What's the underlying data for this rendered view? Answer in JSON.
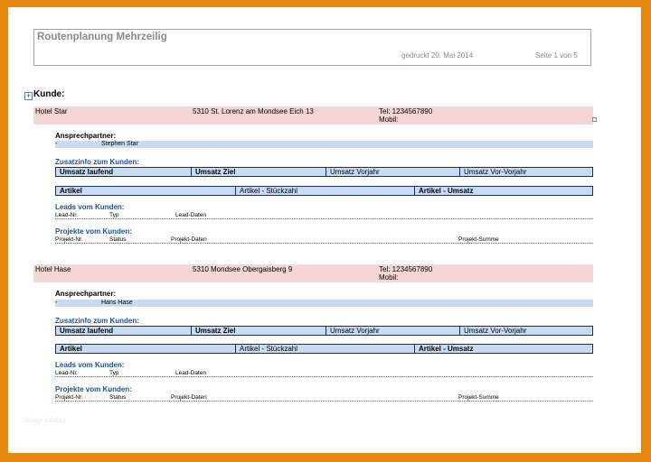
{
  "report": {
    "title": "Routenplanung Mehrzeilig",
    "printed": "gedruckt 20. Mai 2014",
    "page": "Seite 1 von 5",
    "group_label": "Kunde:",
    "expand_glyph": "+"
  },
  "labels": {
    "ansprechpartner": "Ansprechpartner:",
    "zusatzinfo": "Zusatzinfo zum Kunden:",
    "umsatz_laufend": "Umsatz laufend",
    "umsatz_ziel": "Umsatz Ziel",
    "umsatz_vorjahr": "Umsatz Vorjahr",
    "umsatz_vorvorjahr": "Umsatz Vor-Vorjahr",
    "artikel": "Artikel",
    "artikel_stueckzahl": "Artikel - Stückzahl",
    "artikel_umsatz": "Artikel - Umsatz",
    "leads": "Leads vom Kunden:",
    "lead_nr": "Lead-Nr.",
    "typ": "Typ",
    "lead_daten": "Lead-Daten",
    "projekte": "Projekte vom Kunden:",
    "projekt_nr": "Projekt-Nr.",
    "status": "Status",
    "projekt_daten": "Projekt-Daten",
    "projekt_summe": "Projekt-Summe"
  },
  "customers": [
    {
      "name": "Hotel Star",
      "address": "5310 St. Lorenz am Mondsee Eich 13",
      "tel": "Tel: 1234567890",
      "mobil": "Mobil:",
      "contact_dash": "-",
      "contact_name": "Stephen Star"
    },
    {
      "name": "Hotel Hase",
      "address": "5310 Mondsee Obergaisberg 9",
      "tel": "Tel: 1234567890",
      "mobil": "Mobil:",
      "contact_dash": "-",
      "contact_name": "Hans Hase"
    }
  ],
  "watermark": "Vorlage katalog"
}
